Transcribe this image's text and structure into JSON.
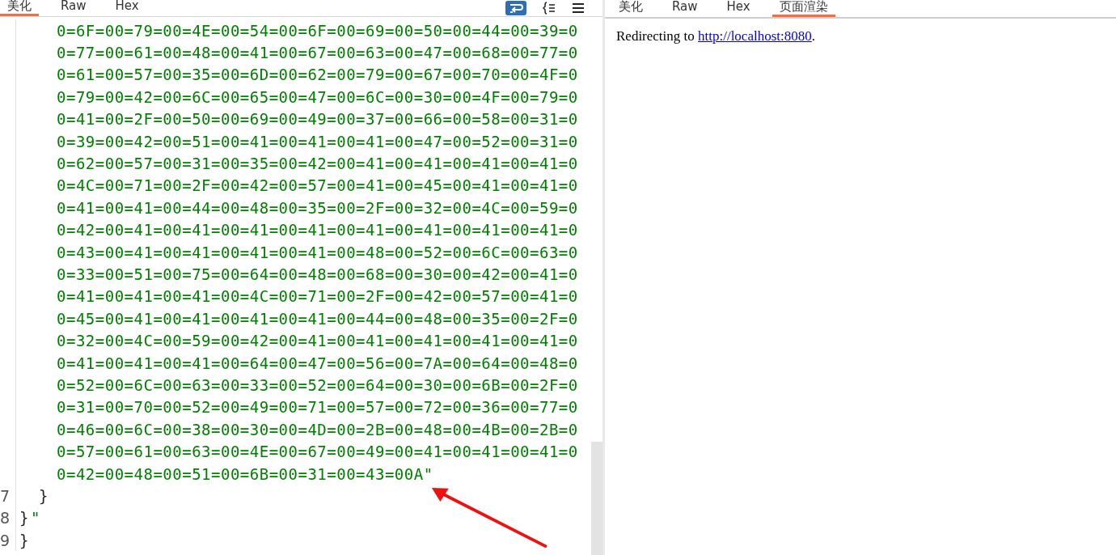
{
  "left_panel": {
    "tabs": [
      {
        "label": "美化",
        "selected": true
      },
      {
        "label": "Raw",
        "selected": false
      },
      {
        "label": "Hex",
        "selected": false
      }
    ],
    "code_lines": [
      {
        "kind": "wrap",
        "segments": [
          {
            "kind": "string",
            "text": "0=6F=00=79=00=4E=00=54=00=6F=00=69=00=50=00=44=00=39=0"
          }
        ]
      },
      {
        "kind": "wrap",
        "segments": [
          {
            "kind": "string",
            "text": "0=77=00=61=00=48=00=41=00=67=00=63=00=47=00=68=00=77=0"
          }
        ]
      },
      {
        "kind": "wrap",
        "segments": [
          {
            "kind": "string",
            "text": "0=61=00=57=00=35=00=6D=00=62=00=79=00=67=00=70=00=4F=0"
          }
        ]
      },
      {
        "kind": "wrap",
        "segments": [
          {
            "kind": "string",
            "text": "0=79=00=42=00=6C=00=65=00=47=00=6C=00=30=00=4F=00=79=0"
          }
        ]
      },
      {
        "kind": "wrap",
        "segments": [
          {
            "kind": "string",
            "text": "0=41=00=2F=00=50=00=69=00=49=00=37=00=66=00=58=00=31=0"
          }
        ]
      },
      {
        "kind": "wrap",
        "segments": [
          {
            "kind": "string",
            "text": "0=39=00=42=00=51=00=41=00=41=00=41=00=47=00=52=00=31=0"
          }
        ]
      },
      {
        "kind": "wrap",
        "segments": [
          {
            "kind": "string",
            "text": "0=62=00=57=00=31=00=35=00=42=00=41=00=41=00=41=00=41=0"
          }
        ]
      },
      {
        "kind": "wrap",
        "segments": [
          {
            "kind": "string",
            "text": "0=4C=00=71=00=2F=00=42=00=57=00=41=00=45=00=41=00=41=0"
          }
        ]
      },
      {
        "kind": "wrap",
        "segments": [
          {
            "kind": "string",
            "text": "0=41=00=41=00=44=00=48=00=35=00=2F=00=32=00=4C=00=59=0"
          }
        ]
      },
      {
        "kind": "wrap",
        "segments": [
          {
            "kind": "string",
            "text": "0=42=00=41=00=41=00=41=00=41=00=41=00=41=00=41=00=41=0"
          }
        ]
      },
      {
        "kind": "wrap",
        "segments": [
          {
            "kind": "string",
            "text": "0=43=00=41=00=41=00=41=00=41=00=48=00=52=00=6C=00=63=0"
          }
        ]
      },
      {
        "kind": "wrap",
        "segments": [
          {
            "kind": "string",
            "text": "0=33=00=51=00=75=00=64=00=48=00=68=00=30=00=42=00=41=0"
          }
        ]
      },
      {
        "kind": "wrap",
        "segments": [
          {
            "kind": "string",
            "text": "0=41=00=41=00=41=00=4C=00=71=00=2F=00=42=00=57=00=41=0"
          }
        ]
      },
      {
        "kind": "wrap",
        "segments": [
          {
            "kind": "string",
            "text": "0=45=00=41=00=41=00=41=00=41=00=44=00=48=00=35=00=2F=0"
          }
        ]
      },
      {
        "kind": "wrap",
        "segments": [
          {
            "kind": "string",
            "text": "0=32=00=4C=00=59=00=42=00=41=00=41=00=41=00=41=00=41=0"
          }
        ]
      },
      {
        "kind": "wrap",
        "segments": [
          {
            "kind": "string",
            "text": "0=41=00=41=00=41=00=64=00=47=00=56=00=7A=00=64=00=48=0"
          }
        ]
      },
      {
        "kind": "wrap",
        "segments": [
          {
            "kind": "string",
            "text": "0=52=00=6C=00=63=00=33=00=52=00=64=00=30=00=6B=00=2F=0"
          }
        ]
      },
      {
        "kind": "wrap",
        "segments": [
          {
            "kind": "string",
            "text": "0=31=00=70=00=52=00=49=00=71=00=57=00=72=00=36=00=77=0"
          }
        ]
      },
      {
        "kind": "wrap",
        "segments": [
          {
            "kind": "string",
            "text": "0=46=00=6C=00=38=00=30=00=4D=00=2B=00=48=00=4B=00=2B=0"
          }
        ]
      },
      {
        "kind": "wrap",
        "segments": [
          {
            "kind": "string",
            "text": "0=57=00=61=00=63=00=4E=00=67=00=49=00=41=00=41=00=41=0"
          }
        ]
      },
      {
        "kind": "wrap",
        "segments": [
          {
            "kind": "string",
            "text": "0=42=00=48=00=51=00=6B=00=31=00=43=00A\""
          }
        ]
      },
      {
        "kind": "numbered",
        "number": "7",
        "segments": [
          {
            "kind": "punct",
            "text": "  }"
          }
        ]
      },
      {
        "kind": "numbered",
        "number": "8",
        "segments": [
          {
            "kind": "punct",
            "text": "}"
          },
          {
            "kind": "string",
            "text": "\""
          }
        ]
      },
      {
        "kind": "numbered",
        "number": "9",
        "segments": [
          {
            "kind": "punct",
            "text": "}"
          }
        ]
      }
    ]
  },
  "right_panel": {
    "tabs": [
      {
        "label": "美化",
        "selected": false
      },
      {
        "label": "Raw",
        "selected": false
      },
      {
        "label": "Hex",
        "selected": false
      },
      {
        "label": "页面渲染",
        "selected": true
      }
    ],
    "page_text": "Redirecting to ",
    "link": "http://localhost:8080",
    "page_text_end": "."
  }
}
